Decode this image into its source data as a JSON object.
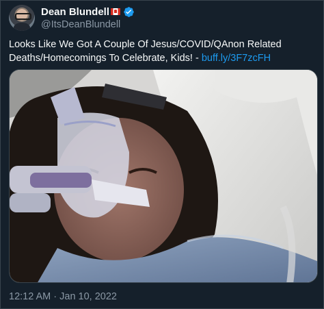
{
  "author": {
    "display_name": "Dean Blundell",
    "handle": "@ItsDeanBlundell",
    "flag_icon": "canada-flag-icon",
    "verified_icon": "verified-badge-icon",
    "verified_color": "#1d9bf0"
  },
  "tweet": {
    "text_line_1": "Looks Like We Got A Couple Of Jesus/COVID/QAnon Related",
    "text_line_2": "Deaths/Homecomings To Celebrate, Kids! - ",
    "link": "buff.ly/3F7zcFH"
  },
  "media": {
    "icon": "photo-patient-with-oxygen-mask"
  },
  "meta": {
    "timestamp": "12:12 AM · Jan 10, 2022"
  },
  "colors": {
    "background": "#15202b",
    "text": "#f7f9f9",
    "secondary_text": "#8b98a5",
    "link": "#1d9bf0",
    "border": "#38444d"
  }
}
